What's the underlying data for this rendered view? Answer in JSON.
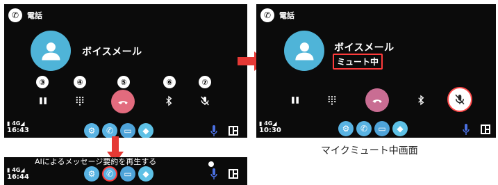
{
  "left_screen": {
    "app_title": "電話",
    "contact_name": "ボイスメール",
    "badges": [
      "③",
      "④",
      "⑤",
      "⑥",
      "⑦"
    ],
    "status": {
      "signal": "4G",
      "time": "16:43"
    },
    "controls": [
      "pause-icon",
      "keypad-icon",
      "hangup-icon",
      "bluetooth-icon",
      "mic-off-icon"
    ]
  },
  "right_screen": {
    "app_title": "電話",
    "contact_name": "ボイスメール",
    "mute_status": "ミュート中",
    "status": {
      "signal": "4G",
      "time": "10:30"
    }
  },
  "bottom_screen": {
    "message_text": "AIによるメッセージ要約を再生する",
    "status": {
      "signal": "4G",
      "time": "16:44"
    }
  },
  "caption": "マイクミュート中画面",
  "colors": {
    "avatar": "#4fb4d8",
    "hangup": "#e26b7e",
    "highlight": "#ff3b3b",
    "arrow": "#e53935"
  }
}
